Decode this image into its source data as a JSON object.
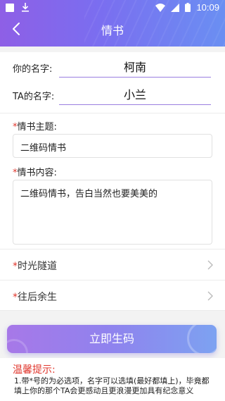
{
  "statusbar": {
    "time": "10:09"
  },
  "header": {
    "title": "情书",
    "back_icon": "chevron-left-icon"
  },
  "names": {
    "your_label": "你的名字:",
    "your_value": "柯南",
    "ta_label": "TA的名字:",
    "ta_value": "小兰"
  },
  "topic": {
    "required_mark": "*",
    "label": "情书主题:",
    "value": "二维码情书"
  },
  "content": {
    "required_mark": "*",
    "label": "情书内容:",
    "value": "二维码情书，告白当然也要美美的"
  },
  "options": [
    {
      "required_mark": "*",
      "label": "时光隧道"
    },
    {
      "required_mark": "*",
      "label": "往后余生"
    }
  ],
  "generate_button": "立即生码",
  "tips": {
    "title": "温馨提示:",
    "text": "1.带*号的为必选项，名字可以选填(最好都填上)，毕竟都填上你的那个TA会更感动且更浪漫更加具有纪念意义"
  },
  "colors": {
    "accent": "#8a6ef0",
    "required": "#e0362c"
  }
}
